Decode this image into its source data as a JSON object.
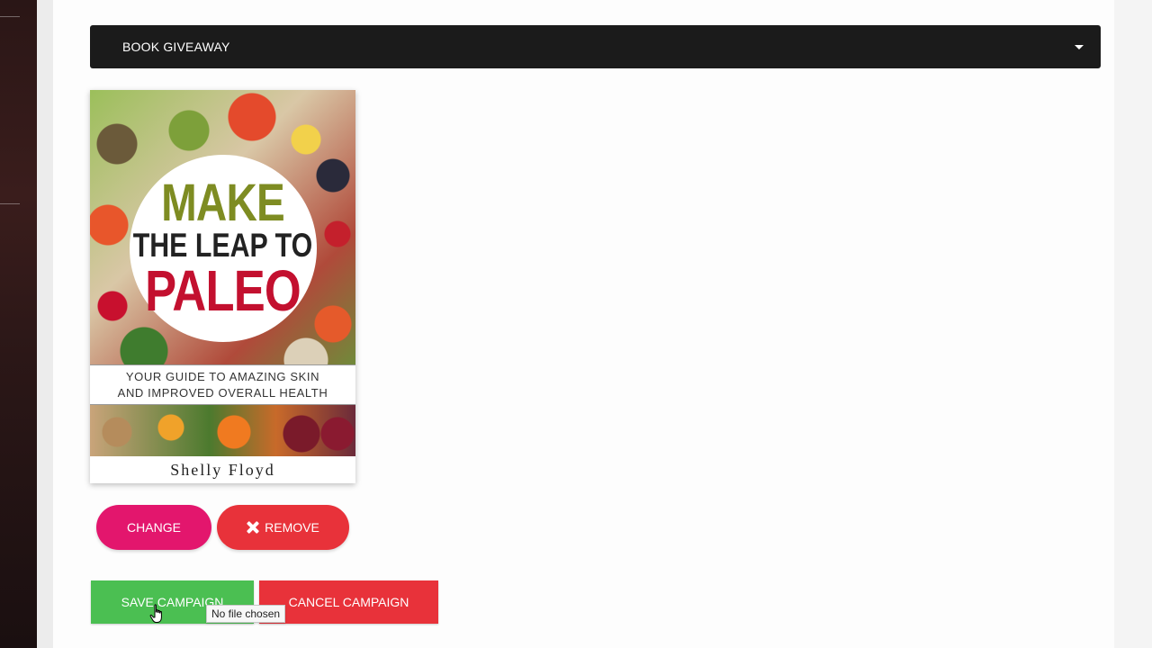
{
  "campaign": {
    "type_dropdown": {
      "selected": "BOOK GIVEAWAY"
    }
  },
  "book": {
    "title_line1": "MAKE",
    "title_line2": "THE LEAP TO",
    "title_line3": "PALEO",
    "subtitle_line1": "YOUR GUIDE TO AMAZING SKIN",
    "subtitle_line2": "AND IMPROVED OVERALL HEALTH",
    "author": "Shelly Floyd"
  },
  "image_actions": {
    "change_label": "CHANGE",
    "remove_label": "REMOVE",
    "remove_icon": "close-icon"
  },
  "form_actions": {
    "save_label": "SAVE CAMPAIGN",
    "cancel_label": "CANCEL CAMPAIGN"
  },
  "tooltip": {
    "text": "No file chosen"
  },
  "colors": {
    "dropdown_bg": "#1b1b1b",
    "change_button": "#e3166d",
    "remove_button": "#e8323a",
    "save_button": "#4bbf52",
    "cancel_button": "#e8323a"
  }
}
